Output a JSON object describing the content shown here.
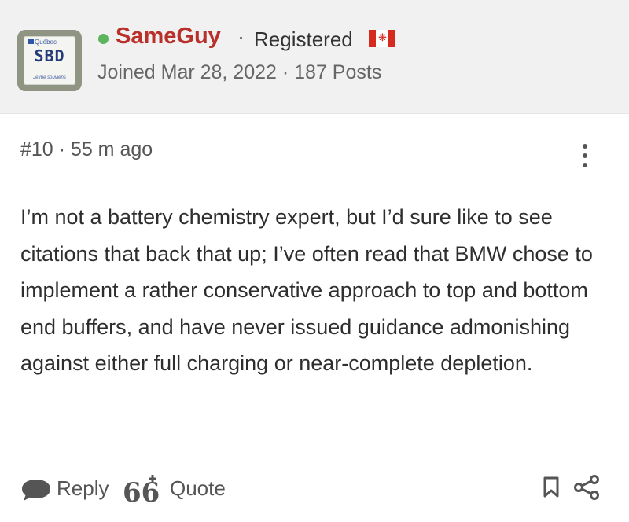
{
  "author": {
    "avatar": {
      "plate_region": "Québec",
      "plate_number": "SBD",
      "plate_motto": "Je me souviens"
    },
    "online": true,
    "username": "SameGuy",
    "separator": "·",
    "role": "Registered",
    "country_flag": "canada-flag-icon",
    "joined": "Joined Mar 28, 2022 · 187 Posts"
  },
  "post": {
    "number": "#10 · 55 m ago",
    "body": "I’m not a battery chemistry expert, but I’d sure like to see citations that back that up; I’ve often read that BMW chose to implement a rather conservative approach to top and bottom end buffers, and have never issued guidance admonishing against either full charging or near-complete depletion."
  },
  "actions": {
    "reply_label": "Reply",
    "quote_label": "Quote",
    "reply_icon": "speech-bubble-icon",
    "quote_icon": "quote-plus-icon",
    "bookmark_icon": "bookmark-icon",
    "share_icon": "share-icon",
    "more_icon": "vertical-ellipsis-icon"
  },
  "colors": {
    "username": "#b9302a",
    "online": "#5ab55d",
    "header_bg": "#f1f1f2"
  }
}
